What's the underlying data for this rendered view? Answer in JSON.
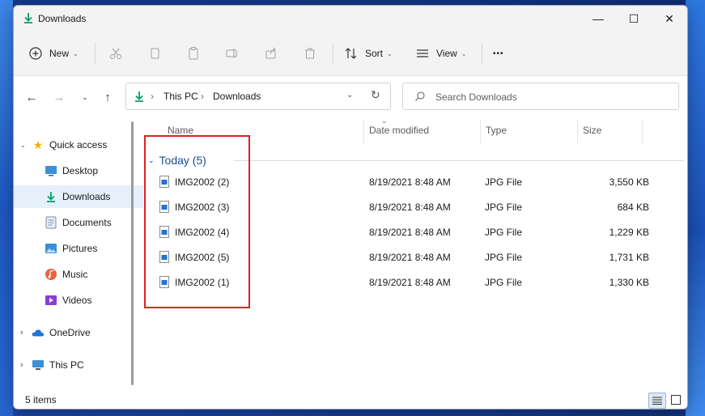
{
  "window": {
    "title": "Downloads",
    "controls": {
      "minimize": "—",
      "maximize": "☐",
      "close": "✕"
    }
  },
  "toolbar": {
    "new_label": "New",
    "sort_label": "Sort",
    "view_label": "View",
    "more_label": "•••"
  },
  "address": {
    "segments": [
      "This PC",
      "Downloads"
    ],
    "search_placeholder": "Search Downloads"
  },
  "nav": {
    "items": [
      {
        "label": "Quick access"
      },
      {
        "label": "Desktop"
      },
      {
        "label": "Downloads"
      },
      {
        "label": "Documents"
      },
      {
        "label": "Pictures"
      },
      {
        "label": "Music"
      },
      {
        "label": "Videos"
      },
      {
        "label": "OneDrive"
      },
      {
        "label": "This PC"
      }
    ],
    "selected": "Downloads"
  },
  "columns": {
    "name": "Name",
    "date": "Date modified",
    "type": "Type",
    "size": "Size"
  },
  "group": {
    "label": "Today (5)"
  },
  "files": [
    {
      "name": "IMG2002 (2)",
      "date": "8/19/2021 8:48 AM",
      "type": "JPG File",
      "size": "3,550 KB"
    },
    {
      "name": "IMG2002 (3)",
      "date": "8/19/2021 8:48 AM",
      "type": "JPG File",
      "size": "684 KB"
    },
    {
      "name": "IMG2002 (4)",
      "date": "8/19/2021 8:48 AM",
      "type": "JPG File",
      "size": "1,229 KB"
    },
    {
      "name": "IMG2002 (5)",
      "date": "8/19/2021 8:48 AM",
      "type": "JPG File",
      "size": "1,731 KB"
    },
    {
      "name": "IMG2002 (1)",
      "date": "8/19/2021 8:48 AM",
      "type": "JPG File",
      "size": "1,330 KB"
    }
  ],
  "status": {
    "count": "5 items"
  },
  "colors": {
    "accent": "#0067c0",
    "selection": "#e5f0fb",
    "highlight_box": "#e02020",
    "group_header": "#1d4c8f"
  }
}
